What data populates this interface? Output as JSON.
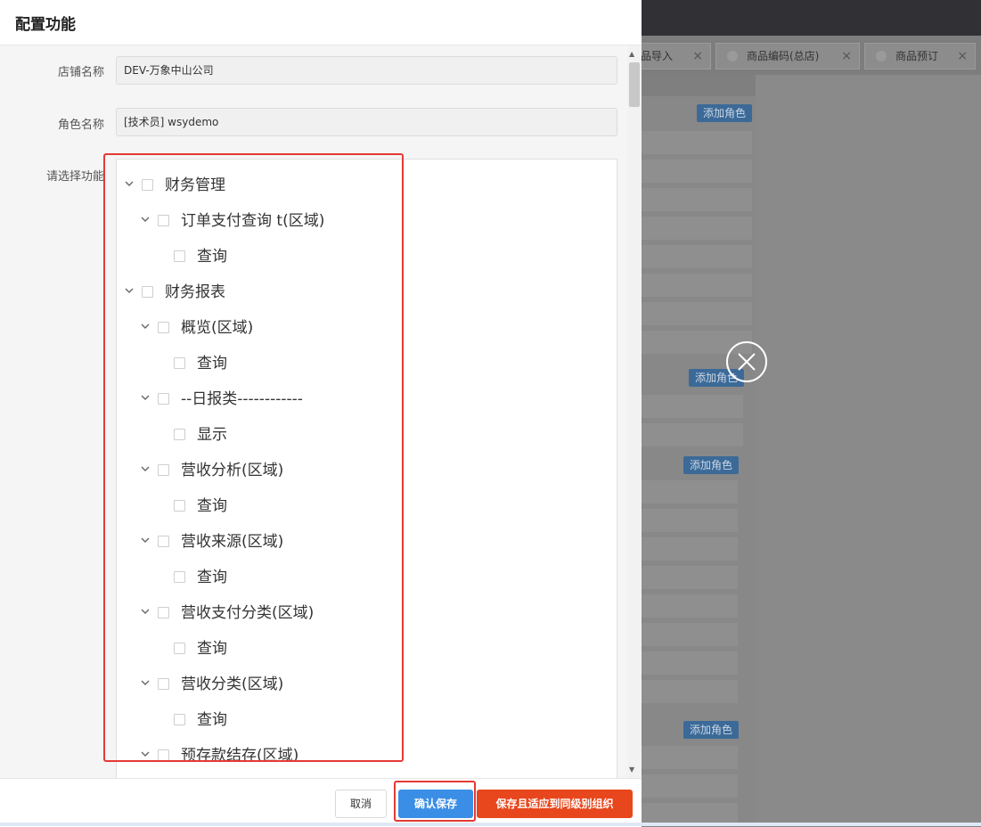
{
  "background": {
    "tabs": [
      {
        "label": "品导入",
        "close": "×"
      },
      {
        "label": "商品编码(总店)",
        "close": "×"
      },
      {
        "label": "商品预订",
        "close": "×"
      }
    ],
    "add_role_badges": [
      "添加角色",
      "添加角色",
      "添加角色",
      "添加角色"
    ]
  },
  "dialog": {
    "title": "配置功能",
    "fields": {
      "store_label": "店铺名称",
      "store_value": "DEV-万象中山公司",
      "role_label": "角色名称",
      "role_value": "[技术员] wsydemo",
      "function_label": "请选择功能"
    },
    "tree": [
      {
        "label": "财务管理",
        "level": 0,
        "expandable": true
      },
      {
        "label": "订单支付查询 t(区域)",
        "level": 1,
        "expandable": true
      },
      {
        "label": "查询",
        "level": 2,
        "expandable": false
      },
      {
        "label": "财务报表",
        "level": 0,
        "expandable": true
      },
      {
        "label": "概览(区域)",
        "level": 1,
        "expandable": true
      },
      {
        "label": "查询",
        "level": 2,
        "expandable": false
      },
      {
        "label": "--日报类------------",
        "level": 1,
        "expandable": true
      },
      {
        "label": "显示",
        "level": 2,
        "expandable": false
      },
      {
        "label": "营收分析(区域)",
        "level": 1,
        "expandable": true
      },
      {
        "label": "查询",
        "level": 2,
        "expandable": false
      },
      {
        "label": "营收来源(区域)",
        "level": 1,
        "expandable": true
      },
      {
        "label": "查询",
        "level": 2,
        "expandable": false
      },
      {
        "label": "营收支付分类(区域)",
        "level": 1,
        "expandable": true
      },
      {
        "label": "查询",
        "level": 2,
        "expandable": false
      },
      {
        "label": "营收分类(区域)",
        "level": 1,
        "expandable": true
      },
      {
        "label": "查询",
        "level": 2,
        "expandable": false
      },
      {
        "label": "预存款结存(区域)",
        "level": 1,
        "expandable": true
      }
    ],
    "footer": {
      "cancel": "取消",
      "confirm": "确认保存",
      "save_apply": "保存且适应到同级别组织"
    }
  },
  "icons": {
    "overlay_close": "close-circle-icon",
    "tree_caret": "chevron-down-icon"
  },
  "colors": {
    "primary": "#3a8ee6",
    "danger": "#e8461c",
    "highlight": "#e53935"
  }
}
